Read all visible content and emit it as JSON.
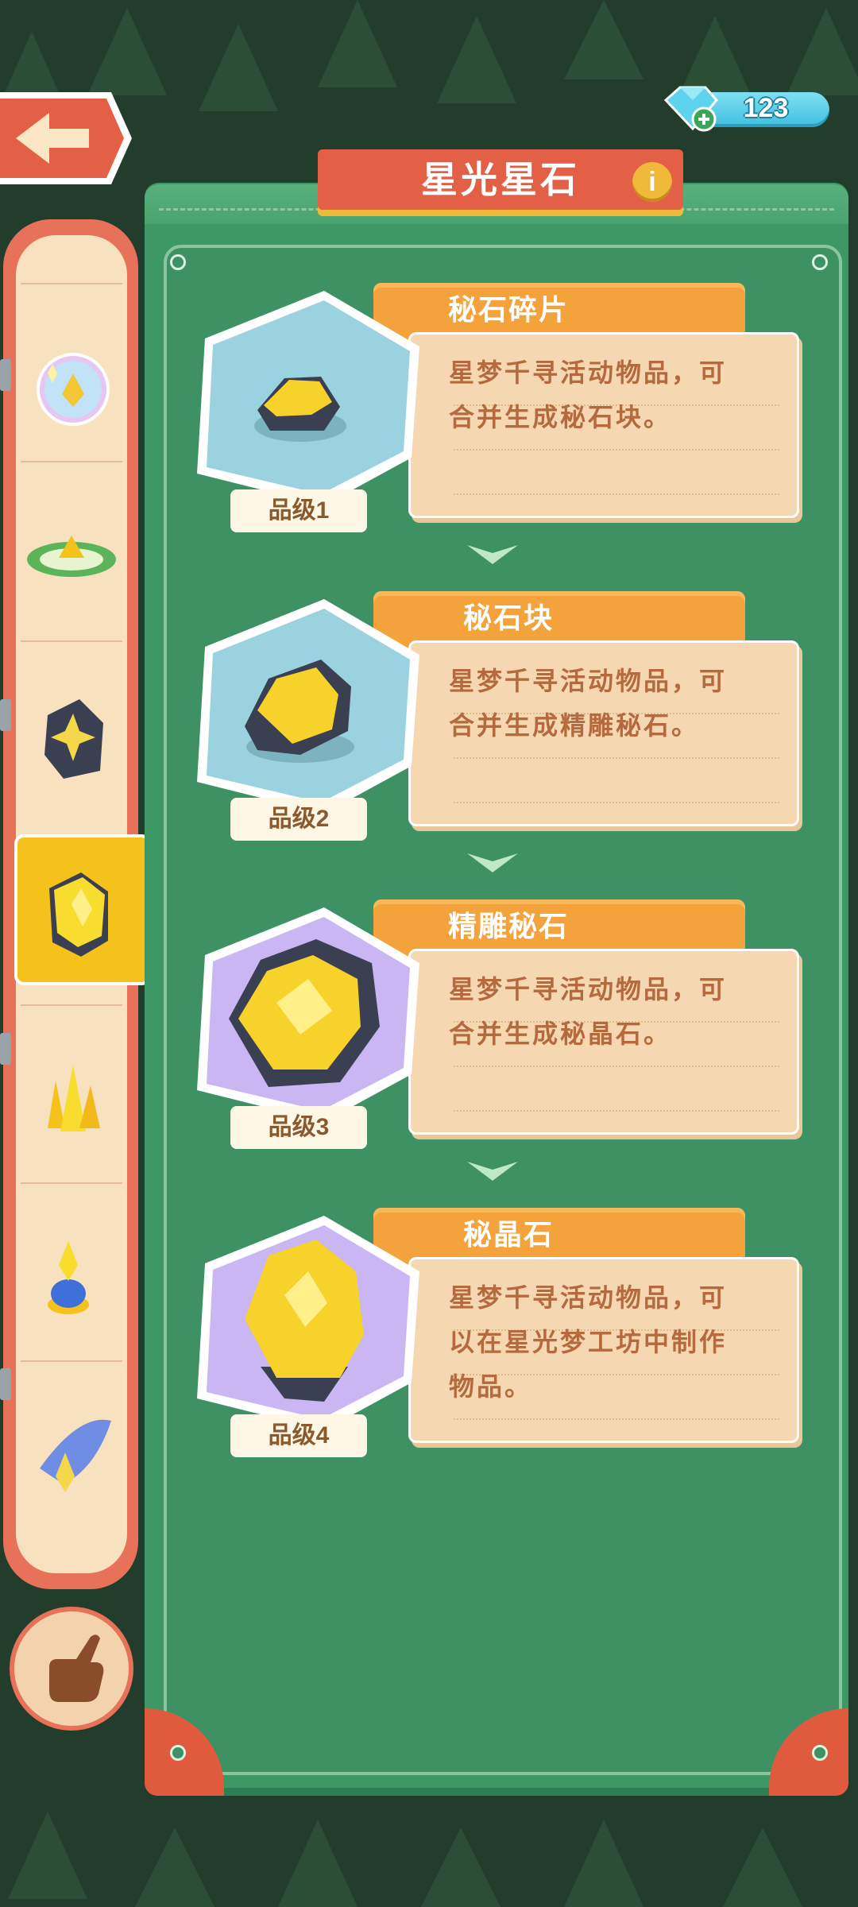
{
  "header": {
    "title": "星光星石",
    "gem_count": "123",
    "info_label": "i"
  },
  "colors": {
    "panel_green": "#3e9866",
    "banner_red": "#e35f45",
    "tab_orange": "#f4a23c",
    "desc_bg": "#f5d8b2",
    "desc_text": "#b56a3e",
    "gold": "#f5c21b"
  },
  "sidebar": {
    "items": [
      {
        "icon": "bubble-gem-icon",
        "selected": false
      },
      {
        "icon": "grass-crystal-icon",
        "selected": false
      },
      {
        "icon": "dark-starstone-icon",
        "selected": false
      },
      {
        "icon": "gold-starstone-icon",
        "selected": true
      },
      {
        "icon": "yellow-crystal-cluster-icon",
        "selected": false
      },
      {
        "icon": "blue-lamp-icon",
        "selected": false
      },
      {
        "icon": "winged-crystal-icon",
        "selected": false
      }
    ],
    "bottom_button_icon": "pointing-hand-icon"
  },
  "cards": [
    {
      "name": "秘石碎片",
      "description": [
        "星梦千寻活动物品，可",
        "合并生成秘石块。"
      ],
      "grade": "品级1",
      "icon": "stone-fragment-icon"
    },
    {
      "name": "秘石块",
      "description": [
        "星梦千寻活动物品，可",
        "合并生成精雕秘石。"
      ],
      "grade": "品级2",
      "icon": "stone-block-icon"
    },
    {
      "name": "精雕秘石",
      "description": [
        "星梦千寻活动物品，可",
        "合并生成秘晶石。"
      ],
      "grade": "品级3",
      "icon": "carved-stone-icon"
    },
    {
      "name": "秘晶石",
      "description": [
        "星梦千寻活动物品，可",
        "以在星光梦工坊中制作",
        "物品。"
      ],
      "grade": "品级4",
      "icon": "crystal-stone-icon"
    }
  ]
}
